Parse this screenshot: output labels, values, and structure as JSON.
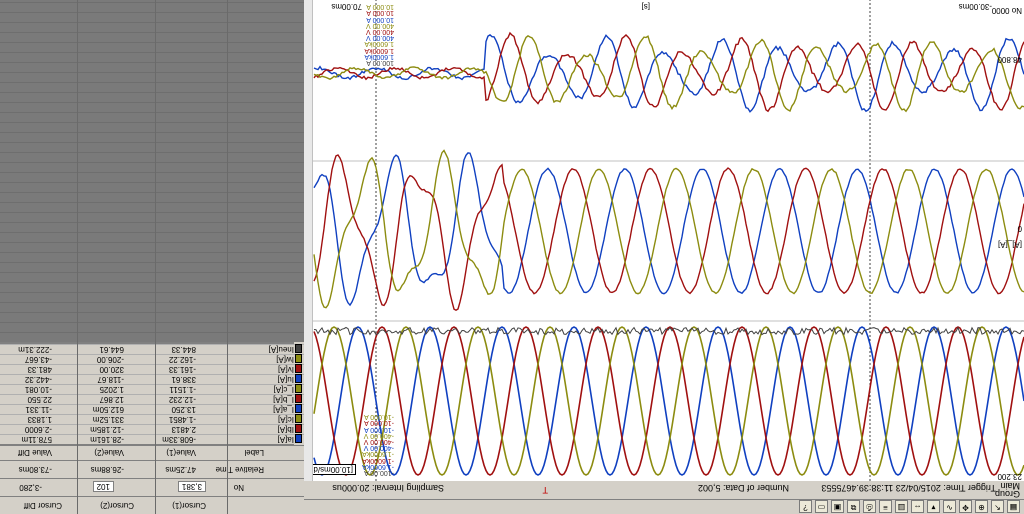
{
  "toolbar": {
    "icons": [
      "grid-icon",
      "cursor-icon",
      "zoom-icon",
      "pan-icon",
      "waveform-icon",
      "marker-icon",
      "measure-icon",
      "fft-icon",
      "list-icon",
      "print-icon",
      "copy-icon",
      "save-icon",
      "open-icon",
      "help-icon"
    ]
  },
  "status": {
    "group": "Group",
    "main": "Main",
    "trigger_time": "Trigger Time: 2015/04/23 11:38:39.4675553",
    "number_of_data": "Number of Data: 5,002",
    "sampling_interval": "Sampling Interval: 20.000us",
    "trigger_mark": "T"
  },
  "plot": {
    "x_left": "-30.00ms",
    "x_center": "[s]",
    "x_right": "70.00ms",
    "time_div": "[10.00ms/div]",
    "y_top": "48.800",
    "y_bottom": "23.200",
    "y_zero": "0",
    "y_unit": "[A]_[A]",
    "no": "No 0000",
    "scale_top": [
      "100.00 A",
      "1.6000kA",
      "1.6000kA",
      "1.6000kA",
      "400.00 V",
      "400.00 V",
      "400.00 V",
      "10.000 A",
      "10.000 A",
      "10.000 A"
    ],
    "scale_bottom": [
      "-100.00 A",
      "-1.6000kA",
      "-1.6000kA",
      "-1.6000kA",
      "-400.00 V",
      "-400.00 V",
      "-400.00 V",
      "-10.000 A",
      "-10.000 A",
      "-10.000 A"
    ]
  },
  "panel": {
    "columns": [
      "Cursor(1)",
      "Cursor(2)",
      "Cursor Diff"
    ],
    "no_label": "No",
    "no_values": [
      "3,381",
      "102",
      ""
    ],
    "no_diff": "-3,280",
    "rel_time_label": "Relative Time",
    "rel_time": [
      "47.25ms",
      "-26.88ms",
      "-73.80ms"
    ],
    "label_header": "Label",
    "value_headers": [
      "Value(1)",
      "Value(2)",
      "Value Diff"
    ],
    "rows": [
      {
        "label": "Ia[A]",
        "color": "#1040c0",
        "v1": "-608.33m",
        "v2": "-28.161m",
        "vd": "578.11m"
      },
      {
        "label": "Ib[A]",
        "color": "#a01010",
        "v1": "2.4813",
        "v2": "-12.185m",
        "vd": "-2.6000"
      },
      {
        "label": "Ic[A]",
        "color": "#8c8c10",
        "v1": "-1.4851",
        "v2": "331.52m",
        "vd": "1.1833"
      },
      {
        "label": "I_a[A]",
        "color": "#1040c0",
        "v1": "13.250",
        "v2": "612.50m",
        "vd": "-11.331"
      },
      {
        "label": "I_b[A]",
        "color": "#a01010",
        "v1": "-12.232",
        "v2": "12.867",
        "vd": "22.550"
      },
      {
        "label": "I_c[A]",
        "color": "#8c8c10",
        "v1": "-1.1511",
        "v2": "1.2025",
        "vd": "-10.081"
      },
      {
        "label": "Iu[A]",
        "color": "#1040c0",
        "v1": "338.61",
        "v2": "-118.67",
        "vd": "-442.32"
      },
      {
        "label": "Iv[A]",
        "color": "#a01010",
        "v1": "-161.33",
        "v2": "320.00",
        "vd": "481.33"
      },
      {
        "label": "Iw[A]",
        "color": "#8c8c10",
        "v1": "-162.22",
        "v2": "-206.00",
        "vd": "-43.667"
      },
      {
        "label": "Ineu[A]",
        "color": "#404040",
        "v1": "844.33",
        "v2": "644.61",
        "vd": "-222.31m"
      }
    ]
  }
}
